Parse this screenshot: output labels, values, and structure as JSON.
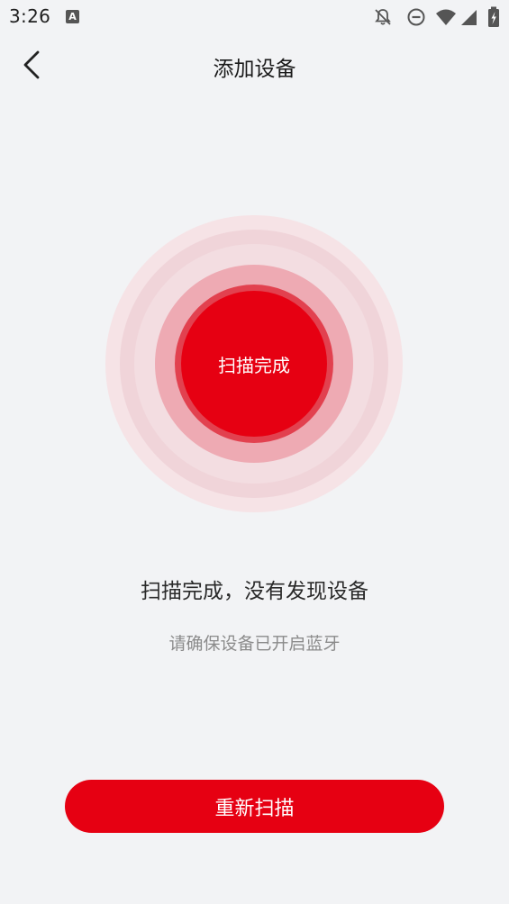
{
  "status_bar": {
    "time": "3:26",
    "notification_icon_letter": "A",
    "icons": [
      "a-notification-icon",
      "bell-off-icon",
      "do-not-disturb-icon",
      "wifi-icon",
      "cellular-signal-icon",
      "battery-charging-icon"
    ]
  },
  "nav": {
    "title": "添加设备",
    "back_icon": "chevron-left-icon"
  },
  "scanner": {
    "status_label": "扫描完成"
  },
  "result": {
    "title": "扫描完成，没有发现设备",
    "hint": "请确保设备已开启蓝牙"
  },
  "actions": {
    "rescan_label": "重新扫描"
  },
  "colors": {
    "accent": "#e60012",
    "background": "#f2f3f5"
  }
}
